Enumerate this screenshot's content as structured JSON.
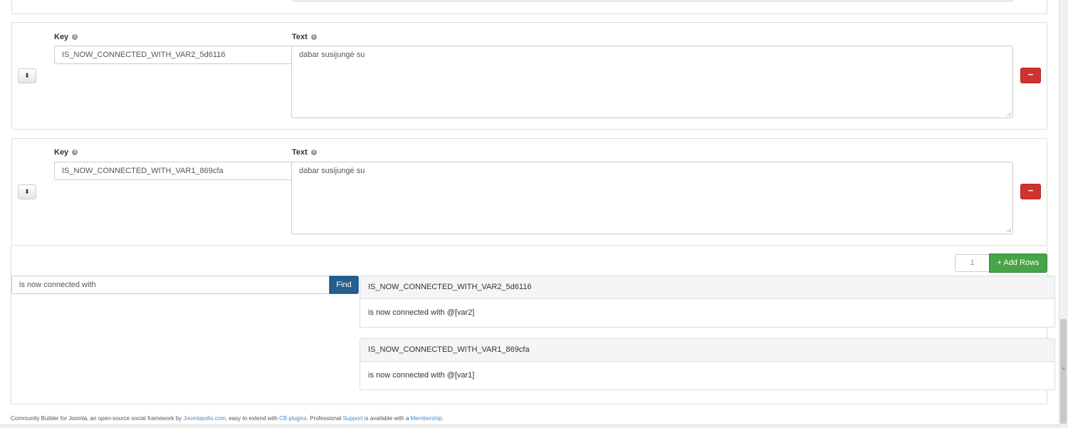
{
  "rows": [
    {
      "key_label": "Key",
      "text_label": "Text",
      "key_value": "IS_NOW_CONNECTED_WITH_VAR2_5d6116",
      "text_value": "dabar susijungė su"
    },
    {
      "key_label": "Key",
      "text_label": "Text",
      "key_value": "IS_NOW_CONNECTED_WITH_VAR1_869cfa",
      "text_value": "dabar susijungė su"
    }
  ],
  "icons": {
    "info": "info-icon",
    "sort": "sort-icon",
    "remove": "minus-icon",
    "add": "plus-icon"
  },
  "glyphs": {
    "info": "i",
    "sort": "⬍",
    "remove": "−",
    "scroll_grip": "≡"
  },
  "add_rows": {
    "count": "1",
    "label": "+ Add Rows"
  },
  "search": {
    "value": "is now connected with",
    "button_label": "Find"
  },
  "results": [
    {
      "key": "IS_NOW_CONNECTED_WITH_VAR2_5d6116",
      "text": "is now connected with @[var2]"
    },
    {
      "key": "IS_NOW_CONNECTED_WITH_VAR1_869cfa",
      "text": "is now connected with @[var1]"
    }
  ],
  "footer": {
    "t1": "Community Builder for Joomla, an open-source social framework by ",
    "l1": "Joomlapolis.com",
    "t2": ", easy to extend with ",
    "l2": "CB plugins",
    "t3": ". Professional ",
    "l3": "Support",
    "t4": " is available with a ",
    "l4": "Membership",
    "t5": "."
  },
  "colors": {
    "danger": "#d2322d",
    "success": "#47a447",
    "primary": "#285e8e",
    "link": "#428bca"
  }
}
